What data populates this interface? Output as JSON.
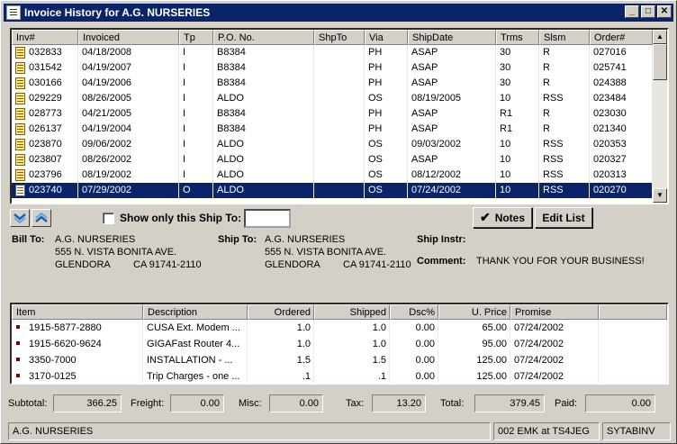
{
  "window": {
    "title": "Invoice History for A.G. NURSERIES",
    "btn_min": "_",
    "btn_max": "□",
    "btn_close": "✕"
  },
  "invoices": {
    "columns": [
      "Inv#",
      "Invoiced",
      "Tp",
      "P.O. No.",
      "ShpTo",
      "Via",
      "ShipDate",
      "Trms",
      "Slsm",
      "Order#"
    ],
    "rows": [
      {
        "inv": "032833",
        "invoiced": "04/18/2008",
        "tp": "I",
        "po": "B8384",
        "shpto": "",
        "via": "PH",
        "shipdate": "ASAP",
        "trms": "30",
        "slsm": "R",
        "order": "027016"
      },
      {
        "inv": "031542",
        "invoiced": "04/19/2007",
        "tp": "I",
        "po": "B8384",
        "shpto": "",
        "via": "PH",
        "shipdate": "ASAP",
        "trms": "30",
        "slsm": "R",
        "order": "025741"
      },
      {
        "inv": "030166",
        "invoiced": "04/19/2006",
        "tp": "I",
        "po": "B8384",
        "shpto": "",
        "via": "PH",
        "shipdate": "ASAP",
        "trms": "30",
        "slsm": "R",
        "order": "024388"
      },
      {
        "inv": "029229",
        "invoiced": "08/26/2005",
        "tp": "I",
        "po": "ALDO",
        "shpto": "",
        "via": "OS",
        "shipdate": "08/19/2005",
        "trms": "10",
        "slsm": "RSS",
        "order": "023484"
      },
      {
        "inv": "028773",
        "invoiced": "04/21/2005",
        "tp": "I",
        "po": "B8384",
        "shpto": "",
        "via": "PH",
        "shipdate": "ASAP",
        "trms": "R1",
        "slsm": "R",
        "order": "023030"
      },
      {
        "inv": "026137",
        "invoiced": "04/19/2004",
        "tp": "I",
        "po": "B8384",
        "shpto": "",
        "via": "PH",
        "shipdate": "ASAP",
        "trms": "R1",
        "slsm": "R",
        "order": "021340"
      },
      {
        "inv": "023870",
        "invoiced": "09/06/2002",
        "tp": "I",
        "po": "ALDO",
        "shpto": "",
        "via": "OS",
        "shipdate": "09/03/2002",
        "trms": "10",
        "slsm": "RSS",
        "order": "020353"
      },
      {
        "inv": "023807",
        "invoiced": "08/26/2002",
        "tp": "I",
        "po": "ALDO",
        "shpto": "",
        "via": "OS",
        "shipdate": "ASAP",
        "trms": "10",
        "slsm": "RSS",
        "order": "020327"
      },
      {
        "inv": "023796",
        "invoiced": "08/19/2002",
        "tp": "I",
        "po": "ALDO",
        "shpto": "",
        "via": "OS",
        "shipdate": "08/12/2002",
        "trms": "10",
        "slsm": "RSS",
        "order": "020313"
      },
      {
        "inv": "023740",
        "invoiced": "07/29/2002",
        "tp": "O",
        "po": "ALDO",
        "shpto": "",
        "via": "OS",
        "shipdate": "07/24/2002",
        "trms": "10",
        "slsm": "RSS",
        "order": "020270",
        "selected": true
      }
    ]
  },
  "toolbar": {
    "nav_down_icon": "expand-down-icon",
    "nav_up_icon": "collapse-up-icon",
    "show_only_ship_to_label": "Show only this Ship To:",
    "ship_to_filter_value": "",
    "notes_button": "Notes",
    "edit_list_button": "Edit List"
  },
  "bill_to": {
    "label": "Bill To:",
    "name": "A.G. NURSERIES",
    "street": "555 N. VISTA BONITA AVE.",
    "city": "GLENDORA",
    "state_zip": "CA 91741-2110"
  },
  "ship_to": {
    "label": "Ship To:",
    "name": "A.G. NURSERIES",
    "street": "555 N. VISTA BONITA AVE.",
    "city": "GLENDORA",
    "state_zip": "CA 91741-2110"
  },
  "ship_instr": {
    "label": "Ship Instr:",
    "value": ""
  },
  "comment": {
    "label": "Comment:",
    "value": "THANK YOU FOR YOUR BUSINESS!"
  },
  "items": {
    "columns": [
      "Item",
      "Description",
      "Ordered",
      "Shipped",
      "Dsc%",
      "U. Price",
      "Promise"
    ],
    "rows": [
      {
        "item": "1915-5877-2880",
        "desc": "CUSA Ext. Modem ...",
        "ordered": "1.0",
        "shipped": "1.0",
        "dsc": "0.00",
        "uprice": "65.00",
        "promise": "07/24/2002"
      },
      {
        "item": "1915-6620-9624",
        "desc": "GIGAFast Router 4...",
        "ordered": "1.0",
        "shipped": "1.0",
        "dsc": "0.00",
        "uprice": "95.00",
        "promise": "07/24/2002"
      },
      {
        "item": "3350-7000",
        "desc": "INSTALLATION - ...",
        "ordered": "1.5",
        "shipped": "1.5",
        "dsc": "0.00",
        "uprice": "125.00",
        "promise": "07/24/2002"
      },
      {
        "item": "3170-0125",
        "desc": "Trip Charges - one ...",
        "ordered": ".1",
        "shipped": ".1",
        "dsc": "0.00",
        "uprice": "125.00",
        "promise": "07/24/2002"
      }
    ]
  },
  "totals": {
    "subtotal_label": "Subtotal:",
    "subtotal": "366.25",
    "freight_label": "Freight:",
    "freight": "0.00",
    "misc_label": "Misc:",
    "misc": "0.00",
    "tax_label": "Tax:",
    "tax": "13.20",
    "total_label": "Total:",
    "total": "379.45",
    "paid_label": "Paid:",
    "paid": "0.00"
  },
  "status_bar": {
    "customer": "A.G. NURSERIES",
    "session": "002 EMK at TS4JEG",
    "program": "SYTABINV"
  },
  "colors": {
    "title_bar": "#0a246a",
    "selection": "#0a246a",
    "window_face": "#d4d0c8"
  }
}
